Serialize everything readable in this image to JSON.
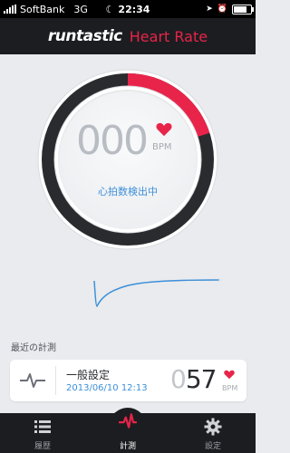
{
  "status_bar": {
    "carrier": "SoftBank",
    "network": "3G",
    "time": "22:34",
    "battery_level": 0.9
  },
  "header": {
    "brand": "runtastic",
    "app_name": "Heart Rate"
  },
  "gauge": {
    "bpm": "000",
    "unit": "BPM",
    "status": "心拍数検出中",
    "progress": 0.2,
    "accent_color": "#e8244a",
    "ring_color": "#2a2b2e"
  },
  "recent": {
    "label": "最近の計測",
    "item": {
      "title": "一般設定",
      "datetime": "2013/06/10 12:13",
      "bpm_leading": "0",
      "bpm_main": "57",
      "unit": "BPM",
      "icon": "pulse-icon"
    }
  },
  "tabs": [
    {
      "label": "履歴",
      "icon": "list-icon",
      "active": false
    },
    {
      "label": "計測",
      "icon": "pulse-icon",
      "active": true
    },
    {
      "label": "設定",
      "icon": "gear-icon",
      "active": false
    }
  ]
}
